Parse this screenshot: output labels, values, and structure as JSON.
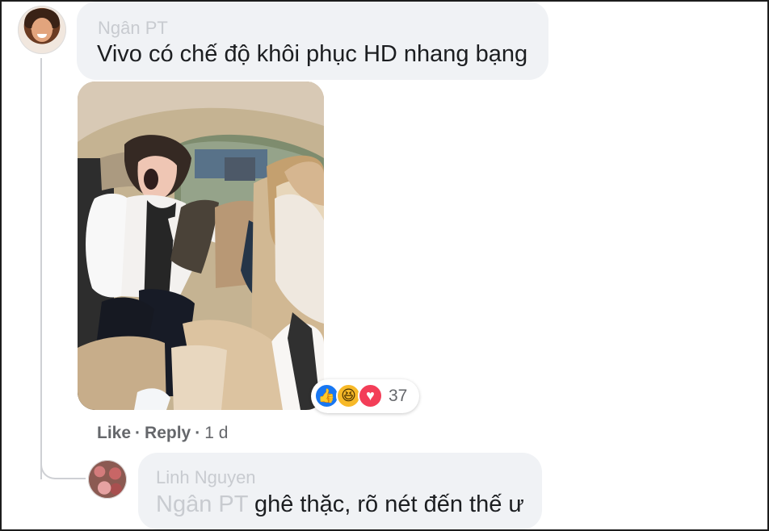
{
  "comment": {
    "author": "Ngân PT",
    "text": "Vivo có chế độ khôi phục HD nhang bạng",
    "reaction_icons": [
      "like-icon",
      "haha-icon",
      "love-icon"
    ],
    "reaction_count": "37",
    "actions": {
      "like": "Like",
      "reply": "Reply",
      "separator": "·",
      "timestamp": "1 d"
    }
  },
  "reply": {
    "author": "Linh Nguyen",
    "mention": "Ngân PT",
    "text": "ghê thặc, rõ nét đến thế ư"
  }
}
